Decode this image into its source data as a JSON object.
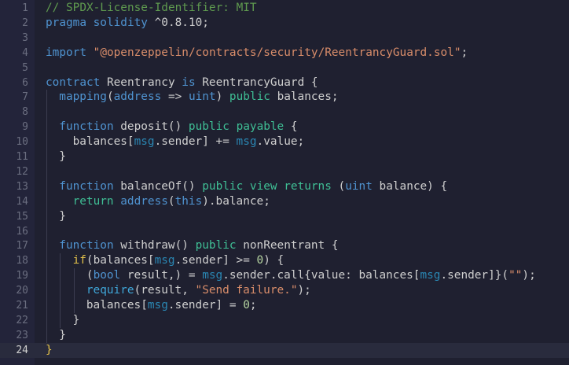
{
  "editor": {
    "current_line": 24,
    "colors": {
      "background": "#1f2030",
      "keyword": "#4f93d0",
      "string": "#d98d6a",
      "comment": "#5f9a4f"
    },
    "lines": [
      {
        "n": "1",
        "indent": 0,
        "tokens": [
          [
            "com",
            "// SPDX-License-Identifier: MIT"
          ]
        ]
      },
      {
        "n": "2",
        "indent": 0,
        "tokens": [
          [
            "kw",
            "pragma solidity"
          ],
          [
            "txt",
            " ^0.8.10;"
          ]
        ]
      },
      {
        "n": "3",
        "indent": 0,
        "tokens": []
      },
      {
        "n": "4",
        "indent": 0,
        "tokens": [
          [
            "kw",
            "import"
          ],
          [
            "txt",
            " "
          ],
          [
            "str",
            "\"@openzeppelin/contracts/security/ReentrancyGuard.sol\""
          ],
          [
            "txt",
            ";"
          ]
        ]
      },
      {
        "n": "5",
        "indent": 0,
        "tokens": []
      },
      {
        "n": "6",
        "indent": 0,
        "tokens": [
          [
            "kw",
            "contract"
          ],
          [
            "txt",
            " Reentrancy "
          ],
          [
            "kw",
            "is"
          ],
          [
            "txt",
            " ReentrancyGuard {"
          ]
        ]
      },
      {
        "n": "7",
        "indent": 1,
        "tokens": [
          [
            "kw",
            "mapping"
          ],
          [
            "txt",
            "("
          ],
          [
            "kw",
            "address"
          ],
          [
            "txt",
            " => "
          ],
          [
            "kw",
            "uint"
          ],
          [
            "txt",
            ") "
          ],
          [
            "pub",
            "public"
          ],
          [
            "txt",
            " balances;"
          ]
        ]
      },
      {
        "n": "8",
        "indent": 0,
        "tokens": []
      },
      {
        "n": "9",
        "indent": 1,
        "tokens": [
          [
            "kw",
            "function"
          ],
          [
            "txt",
            " deposit() "
          ],
          [
            "pub",
            "public"
          ],
          [
            "txt",
            " "
          ],
          [
            "pub",
            "payable"
          ],
          [
            "txt",
            " {"
          ]
        ]
      },
      {
        "n": "10",
        "indent": 2,
        "tokens": [
          [
            "txt",
            "balances["
          ],
          [
            "msg",
            "msg"
          ],
          [
            "txt",
            ".sender] += "
          ],
          [
            "msg",
            "msg"
          ],
          [
            "txt",
            ".value;"
          ]
        ]
      },
      {
        "n": "11",
        "indent": 1,
        "tokens": [
          [
            "txt",
            "}"
          ]
        ]
      },
      {
        "n": "12",
        "indent": 0,
        "tokens": []
      },
      {
        "n": "13",
        "indent": 1,
        "tokens": [
          [
            "kw",
            "function"
          ],
          [
            "txt",
            " balanceOf() "
          ],
          [
            "pub",
            "public"
          ],
          [
            "txt",
            " "
          ],
          [
            "pub",
            "view"
          ],
          [
            "txt",
            " "
          ],
          [
            "pub",
            "returns"
          ],
          [
            "txt",
            " ("
          ],
          [
            "kw",
            "uint"
          ],
          [
            "txt",
            " balance) {"
          ]
        ]
      },
      {
        "n": "14",
        "indent": 2,
        "tokens": [
          [
            "pub",
            "return"
          ],
          [
            "txt",
            " "
          ],
          [
            "kw",
            "address"
          ],
          [
            "txt",
            "("
          ],
          [
            "kw",
            "this"
          ],
          [
            "txt",
            ").balance;"
          ]
        ]
      },
      {
        "n": "15",
        "indent": 1,
        "tokens": [
          [
            "txt",
            "}"
          ]
        ]
      },
      {
        "n": "16",
        "indent": 0,
        "tokens": []
      },
      {
        "n": "17",
        "indent": 1,
        "tokens": [
          [
            "kw",
            "function"
          ],
          [
            "txt",
            " withdraw() "
          ],
          [
            "pub",
            "public"
          ],
          [
            "txt",
            " nonReentrant {"
          ]
        ]
      },
      {
        "n": "18",
        "indent": 2,
        "tokens": [
          [
            "ctl",
            "if"
          ],
          [
            "txt",
            "(balances["
          ],
          [
            "msg",
            "msg"
          ],
          [
            "txt",
            ".sender] >= "
          ],
          [
            "num",
            "0"
          ],
          [
            "txt",
            ") {"
          ]
        ]
      },
      {
        "n": "19",
        "indent": 3,
        "tokens": [
          [
            "txt",
            "("
          ],
          [
            "kw",
            "bool"
          ],
          [
            "txt",
            " result,) = "
          ],
          [
            "msg",
            "msg"
          ],
          [
            "txt",
            ".sender.call{value: balances["
          ],
          [
            "msg",
            "msg"
          ],
          [
            "txt",
            ".sender]}("
          ],
          [
            "str",
            "\"\""
          ],
          [
            "txt",
            ");"
          ]
        ]
      },
      {
        "n": "20",
        "indent": 3,
        "tokens": [
          [
            "bi",
            "require"
          ],
          [
            "txt",
            "(result, "
          ],
          [
            "str",
            "\"Send failure.\""
          ],
          [
            "txt",
            ");"
          ]
        ]
      },
      {
        "n": "21",
        "indent": 3,
        "tokens": [
          [
            "txt",
            "balances["
          ],
          [
            "msg",
            "msg"
          ],
          [
            "txt",
            ".sender] = "
          ],
          [
            "num",
            "0"
          ],
          [
            "txt",
            ";"
          ]
        ]
      },
      {
        "n": "22",
        "indent": 2,
        "tokens": [
          [
            "txt",
            "}"
          ]
        ]
      },
      {
        "n": "23",
        "indent": 1,
        "tokens": [
          [
            "txt",
            "}"
          ]
        ]
      },
      {
        "n": "24",
        "indent": 0,
        "tokens": [
          [
            "ctl",
            "}"
          ]
        ]
      }
    ]
  }
}
